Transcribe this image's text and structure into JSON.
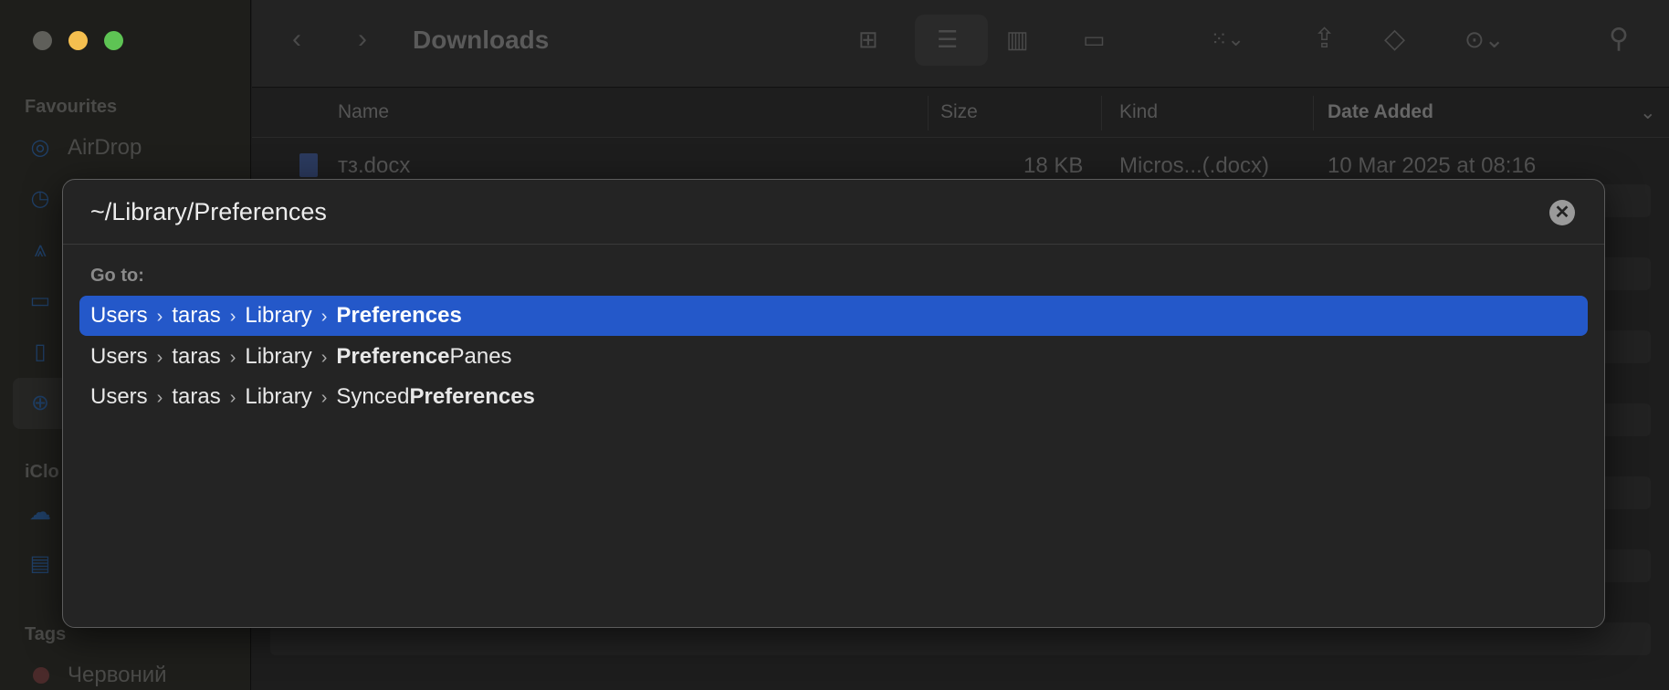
{
  "sidebar": {
    "favourites": "Favourites",
    "airdrop": "AirDrop",
    "icloud": "iClo",
    "tags": "Tags",
    "tag_red": "Червоний"
  },
  "toolbar": {
    "title": "Downloads"
  },
  "columns": {
    "name": "Name",
    "size": "Size",
    "kind": "Kind",
    "date": "Date Added"
  },
  "file": {
    "name": "тз.docx",
    "size": "18 KB",
    "kind": "Micros...(.docx)",
    "date": "10 Mar 2025 at 08:16"
  },
  "dialog": {
    "path": "~/Library/Preferences",
    "goto": "Go to:",
    "sep": "›",
    "results": [
      {
        "p1": "Users",
        "p2": "taras",
        "p3": "Library",
        "pre": "",
        "bold": "Preferences",
        "post": ""
      },
      {
        "p1": "Users",
        "p2": "taras",
        "p3": "Library",
        "pre": "",
        "bold": "Preference",
        "post": "Panes"
      },
      {
        "p1": "Users",
        "p2": "taras",
        "p3": "Library",
        "pre": "Synced",
        "bold": "Preferences",
        "post": ""
      }
    ]
  },
  "colors": {
    "accent": "#2458c9"
  }
}
